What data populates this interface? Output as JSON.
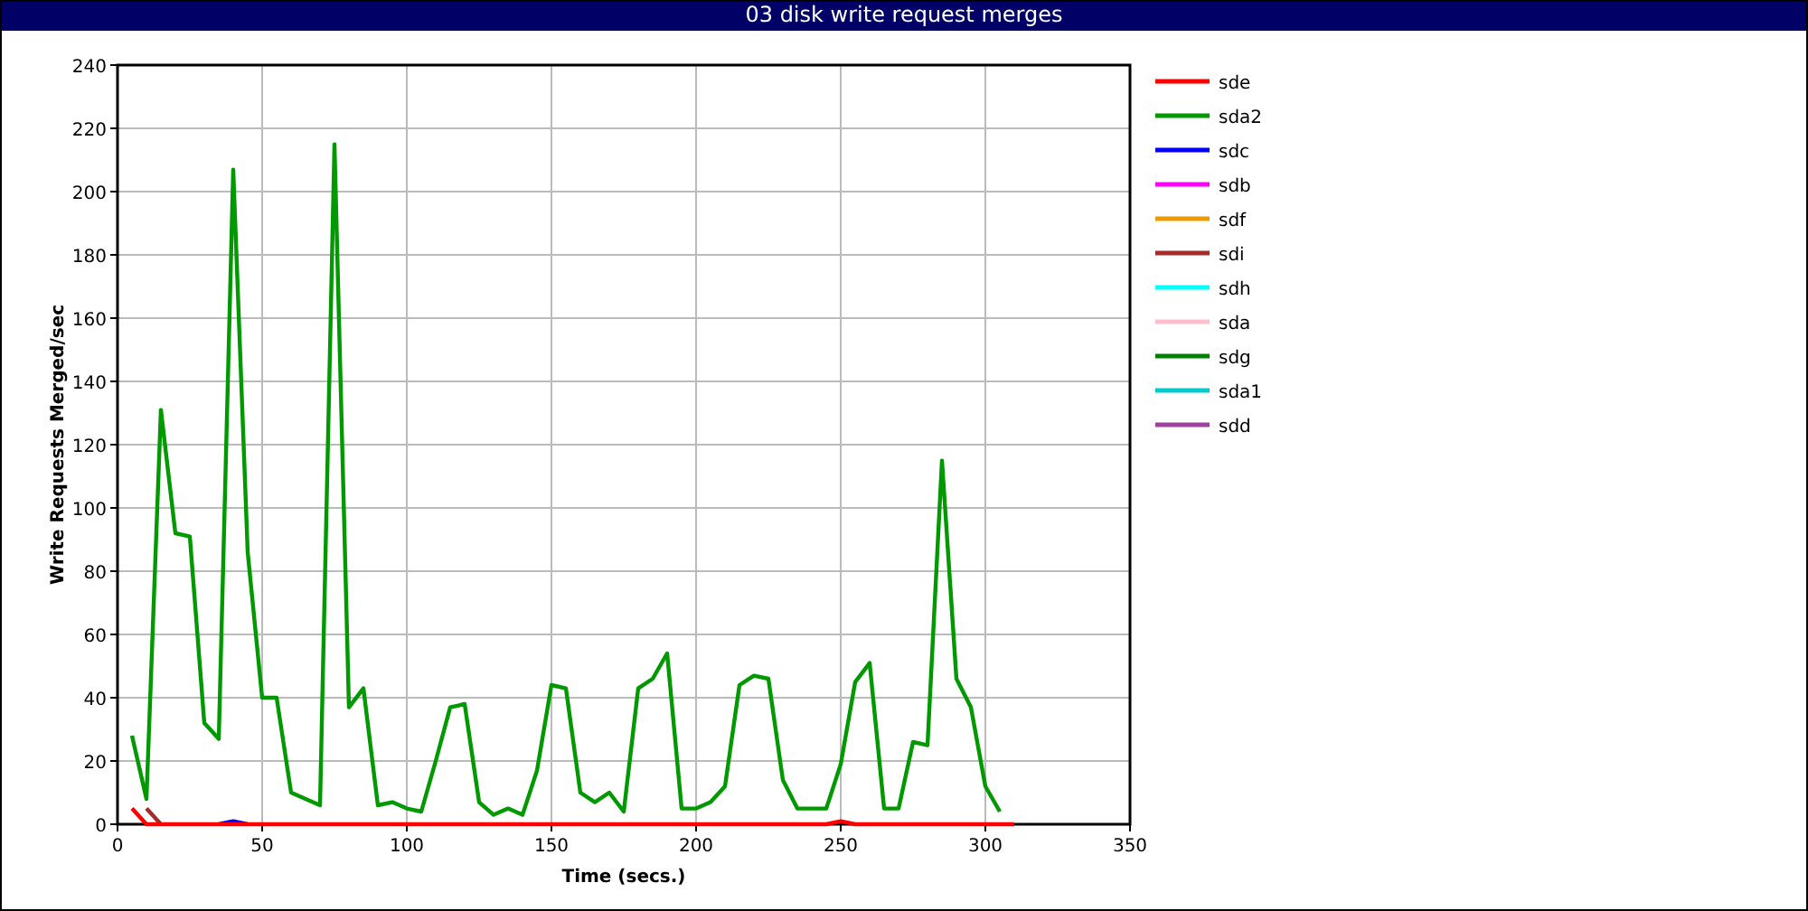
{
  "window": {
    "title": "03 disk write request merges"
  },
  "chart_data": {
    "type": "line",
    "xlabel": "Time (secs.)",
    "ylabel": "Write Requests Merged/sec",
    "xlim": [
      0,
      350
    ],
    "ylim": [
      0,
      240
    ],
    "grid": true,
    "legend": true,
    "xticks": [
      0,
      50,
      100,
      150,
      200,
      250,
      300,
      350
    ],
    "yticks": [
      0,
      20,
      40,
      60,
      80,
      100,
      120,
      140,
      160,
      180,
      200,
      220,
      240
    ],
    "x": [
      5,
      10,
      15,
      20,
      25,
      30,
      35,
      40,
      45,
      50,
      55,
      60,
      65,
      70,
      75,
      80,
      85,
      90,
      95,
      100,
      105,
      110,
      115,
      120,
      125,
      130,
      135,
      140,
      145,
      150,
      155,
      160,
      165,
      170,
      175,
      180,
      185,
      190,
      195,
      200,
      205,
      210,
      215,
      220,
      225,
      230,
      235,
      240,
      245,
      250,
      255,
      260,
      265,
      270,
      275,
      280,
      285,
      290,
      295,
      300,
      305,
      310
    ],
    "series": [
      {
        "name": "sde",
        "color": "#ff0000",
        "values": [
          5,
          0,
          0,
          0,
          0,
          0,
          0,
          0,
          0,
          0,
          0,
          0,
          0,
          0,
          0,
          0,
          0,
          0,
          0,
          0,
          0,
          0,
          0,
          0,
          0,
          0,
          0,
          0,
          0,
          0,
          0,
          0,
          0,
          0,
          0,
          0,
          0,
          0,
          0,
          0,
          0,
          0,
          0,
          0,
          0,
          0,
          0,
          0,
          0,
          1,
          0,
          0,
          0,
          0,
          0,
          0,
          0,
          0,
          0,
          0,
          0,
          0
        ]
      },
      {
        "name": "sda2",
        "color": "#009900",
        "values": [
          28,
          8,
          131,
          92,
          91,
          32,
          27,
          207,
          86,
          40,
          40,
          10,
          8,
          6,
          215,
          37,
          43,
          6,
          7,
          5,
          4,
          20,
          37,
          38,
          7,
          3,
          5,
          3,
          17,
          44,
          43,
          10,
          7,
          10,
          4,
          43,
          46,
          54,
          5,
          5,
          7,
          12,
          44,
          47,
          46,
          14,
          5,
          5,
          5,
          19,
          45,
          51,
          5,
          5,
          26,
          25,
          115,
          46,
          37,
          12,
          4,
          null
        ]
      },
      {
        "name": "sdc",
        "color": "#0000ff",
        "values": [
          null,
          null,
          null,
          null,
          null,
          null,
          0,
          1,
          0,
          null,
          null,
          null,
          null,
          null,
          null,
          null,
          null,
          null,
          null,
          null,
          null,
          null,
          null,
          null,
          null,
          null,
          null,
          null,
          null,
          null,
          null,
          null,
          null,
          null,
          null,
          null,
          null,
          null,
          null,
          null,
          null,
          null,
          null,
          null,
          null,
          null,
          null,
          null,
          null,
          null,
          null,
          null,
          null,
          null,
          null,
          null,
          null,
          null,
          null,
          null,
          null,
          null
        ]
      },
      {
        "name": "sdb",
        "color": "#ff00ff",
        "values": [
          null,
          null,
          null,
          null,
          null,
          null,
          null,
          null,
          null,
          null,
          null,
          null,
          null,
          null,
          null,
          null,
          null,
          null,
          null,
          null,
          null,
          null,
          null,
          null,
          null,
          null,
          null,
          null,
          null,
          null,
          null,
          null,
          null,
          null,
          null,
          null,
          null,
          null,
          null,
          null,
          null,
          null,
          null,
          null,
          null,
          null,
          null,
          null,
          null,
          null,
          null,
          null,
          null,
          null,
          null,
          null,
          null,
          null,
          null,
          null,
          null,
          null
        ]
      },
      {
        "name": "sdf",
        "color": "#ee9900",
        "values": [
          null,
          null,
          null,
          null,
          null,
          null,
          null,
          null,
          null,
          null,
          null,
          null,
          null,
          null,
          null,
          null,
          null,
          null,
          null,
          null,
          null,
          null,
          null,
          null,
          null,
          null,
          null,
          null,
          null,
          null,
          null,
          null,
          null,
          null,
          null,
          null,
          null,
          null,
          null,
          null,
          null,
          null,
          null,
          null,
          null,
          null,
          null,
          null,
          null,
          null,
          null,
          null,
          null,
          null,
          null,
          null,
          null,
          null,
          null,
          null,
          null,
          null
        ]
      },
      {
        "name": "sdi",
        "color": "#a52a2a",
        "values": [
          null,
          5,
          0,
          null,
          null,
          null,
          null,
          null,
          null,
          null,
          null,
          null,
          null,
          null,
          null,
          null,
          null,
          null,
          null,
          null,
          null,
          null,
          null,
          null,
          null,
          null,
          null,
          null,
          null,
          null,
          null,
          null,
          null,
          null,
          null,
          null,
          null,
          null,
          null,
          null,
          null,
          null,
          null,
          null,
          null,
          null,
          null,
          null,
          null,
          null,
          null,
          null,
          null,
          null,
          null,
          null,
          null,
          null,
          null,
          null,
          null,
          null
        ]
      },
      {
        "name": "sdh",
        "color": "#00ffff",
        "values": [
          null,
          null,
          null,
          null,
          null,
          null,
          null,
          null,
          null,
          null,
          null,
          null,
          null,
          null,
          null,
          null,
          null,
          null,
          null,
          null,
          null,
          null,
          null,
          null,
          null,
          null,
          null,
          null,
          null,
          null,
          null,
          null,
          null,
          null,
          null,
          null,
          null,
          null,
          null,
          null,
          null,
          null,
          null,
          null,
          null,
          null,
          null,
          null,
          null,
          null,
          null,
          null,
          null,
          null,
          null,
          null,
          null,
          null,
          null,
          null,
          null,
          null
        ]
      },
      {
        "name": "sda",
        "color": "#ffc0cb",
        "values": [
          null,
          null,
          null,
          null,
          null,
          null,
          null,
          null,
          null,
          null,
          null,
          null,
          null,
          null,
          null,
          null,
          null,
          null,
          null,
          null,
          null,
          null,
          null,
          null,
          null,
          null,
          null,
          null,
          null,
          null,
          null,
          null,
          null,
          null,
          null,
          null,
          null,
          null,
          null,
          null,
          null,
          null,
          null,
          null,
          null,
          null,
          null,
          null,
          null,
          null,
          null,
          null,
          null,
          null,
          null,
          null,
          null,
          null,
          null,
          null,
          null,
          null
        ]
      },
      {
        "name": "sdg",
        "color": "#008000",
        "values": [
          null,
          null,
          null,
          null,
          null,
          null,
          null,
          null,
          null,
          null,
          null,
          null,
          null,
          null,
          null,
          null,
          null,
          null,
          null,
          null,
          null,
          null,
          null,
          null,
          null,
          null,
          null,
          null,
          null,
          null,
          null,
          null,
          null,
          null,
          null,
          null,
          null,
          null,
          null,
          null,
          null,
          null,
          null,
          null,
          null,
          null,
          null,
          null,
          null,
          null,
          null,
          null,
          null,
          null,
          null,
          null,
          null,
          null,
          null,
          null,
          null,
          null
        ]
      },
      {
        "name": "sda1",
        "color": "#00cccc",
        "values": [
          null,
          null,
          null,
          null,
          null,
          null,
          null,
          null,
          null,
          null,
          null,
          null,
          null,
          null,
          null,
          null,
          null,
          null,
          null,
          null,
          null,
          null,
          null,
          null,
          null,
          null,
          null,
          null,
          null,
          null,
          null,
          null,
          null,
          null,
          null,
          null,
          null,
          null,
          null,
          null,
          null,
          null,
          null,
          null,
          null,
          null,
          null,
          null,
          null,
          null,
          null,
          null,
          null,
          null,
          null,
          null,
          null,
          null,
          null,
          null,
          null,
          null
        ]
      },
      {
        "name": "sdd",
        "color": "#a040a0",
        "values": [
          null,
          null,
          null,
          null,
          null,
          null,
          null,
          null,
          null,
          null,
          null,
          null,
          null,
          null,
          null,
          null,
          null,
          null,
          null,
          null,
          null,
          null,
          null,
          null,
          null,
          null,
          null,
          null,
          null,
          null,
          null,
          null,
          null,
          null,
          null,
          null,
          null,
          null,
          null,
          null,
          null,
          null,
          null,
          null,
          null,
          null,
          null,
          null,
          null,
          null,
          null,
          null,
          null,
          null,
          null,
          null,
          null,
          null,
          null,
          null,
          null,
          null
        ]
      }
    ]
  }
}
